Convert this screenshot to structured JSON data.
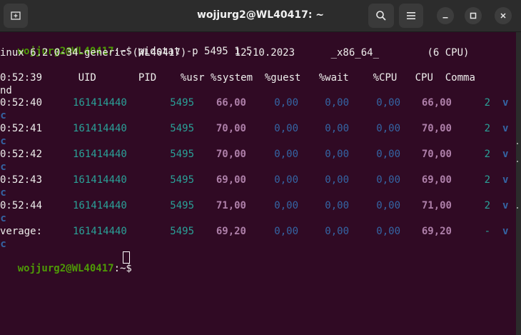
{
  "window": {
    "title": "wojjurg2@WL40417: ~",
    "buttons": [
      "new-tab-icon",
      "search-icon",
      "menu-icon",
      "minimize-icon",
      "maximize-icon",
      "close-icon"
    ]
  },
  "colors": {
    "background": "#300a24",
    "prompt_user": "#4e9a06",
    "text": "#eeeeec",
    "uid": "#2aa198",
    "usr": "#ad7fa8",
    "zero": "#3465a4"
  },
  "terminal": {
    "prompt_user": "wojjurg2@WL40417",
    "prompt_rest": ":~$ pidstat -p 5495 1 5",
    "prompt2_rest": ":~$ ",
    "sysinfo": "inux 6.2.0-34-generic (WL40417)        12.10.2023      _x86_64_        (6 CPU)",
    "header": "0:52:39      UID       PID    %usr %system  %guest   %wait    %CPU   CPU  Comma",
    "header_wrap": "nd",
    "rows": [
      {
        "time": "0:52:40",
        "uid": "161414440",
        "pid": "5495",
        "usr": "66,00",
        "system": "0,00",
        "guest": "0,00",
        "wait": "0,00",
        "cpu_pct": "66,00",
        "cpu": "2",
        "cmd": "v",
        "wrap": "ic"
      },
      {
        "time": "0:52:41",
        "uid": "161414440",
        "pid": "5495",
        "usr": "70,00",
        "system": "0,00",
        "guest": "0,00",
        "wait": "0,00",
        "cpu_pct": "70,00",
        "cpu": "2",
        "cmd": "v",
        "wrap": "ic"
      },
      {
        "time": "0:52:42",
        "uid": "161414440",
        "pid": "5495",
        "usr": "70,00",
        "system": "0,00",
        "guest": "0,00",
        "wait": "0,00",
        "cpu_pct": "70,00",
        "cpu": "2",
        "cmd": "v",
        "wrap": "ic"
      },
      {
        "time": "0:52:43",
        "uid": "161414440",
        "pid": "5495",
        "usr": "69,00",
        "system": "0,00",
        "guest": "0,00",
        "wait": "0,00",
        "cpu_pct": "69,00",
        "cpu": "2",
        "cmd": "v",
        "wrap": "ic"
      },
      {
        "time": "0:52:44",
        "uid": "161414440",
        "pid": "5495",
        "usr": "71,00",
        "system": "0,00",
        "guest": "0,00",
        "wait": "0,00",
        "cpu_pct": "71,00",
        "cpu": "2",
        "cmd": "v",
        "wrap": "ic"
      },
      {
        "time": "verage:",
        "uid": "161414440",
        "pid": "5495",
        "usr": "69,20",
        "system": "0,00",
        "guest": "0,00",
        "wait": "0,00",
        "cpu_pct": "69,20",
        "cpu": "-",
        "cmd": "v",
        "wrap": "ic"
      }
    ]
  }
}
